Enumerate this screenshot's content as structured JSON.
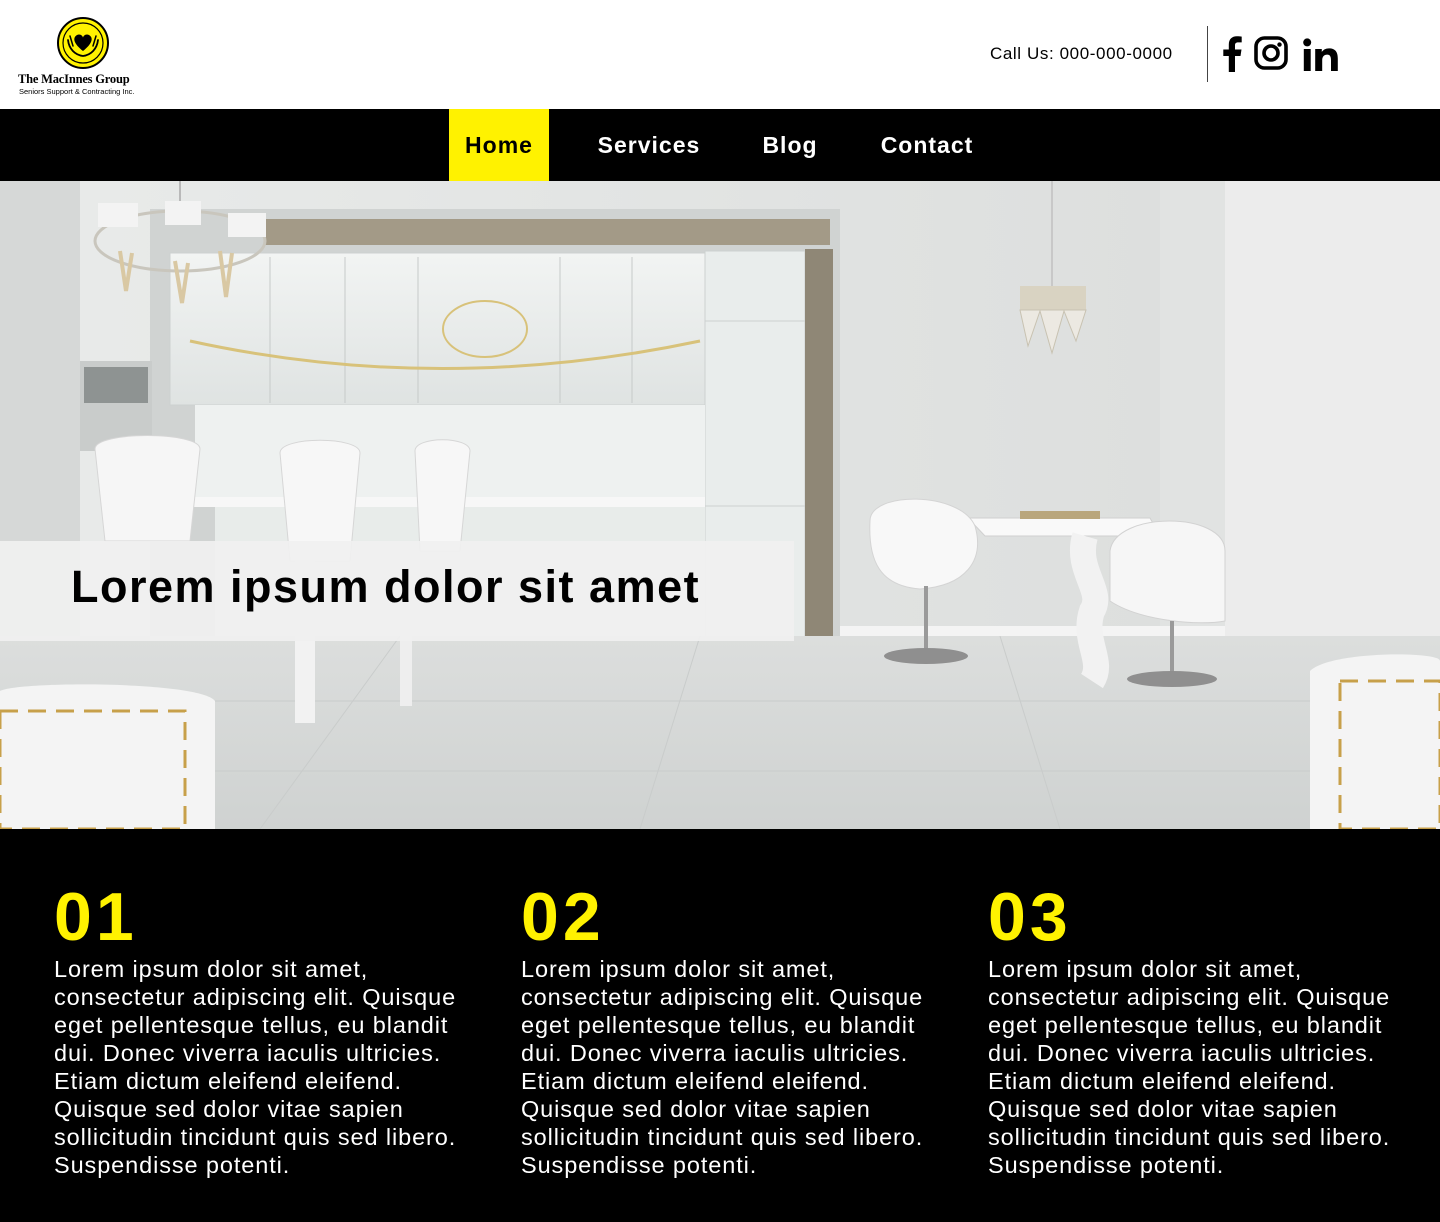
{
  "brand": {
    "name": "The MacInnes Group",
    "tagline": "Seniors Support & Contracting Inc.",
    "accent_color": "#FFF200",
    "logo_icon": "hands-holding-heart-icon"
  },
  "header": {
    "call_label": "Call Us: 000-000-0000",
    "social": [
      {
        "name": "facebook",
        "icon": "facebook-icon"
      },
      {
        "name": "instagram",
        "icon": "instagram-icon"
      },
      {
        "name": "linkedin",
        "icon": "linkedin-icon"
      }
    ]
  },
  "nav": {
    "items": [
      {
        "label": "Home",
        "active": true
      },
      {
        "label": "Services",
        "active": false
      },
      {
        "label": "Blog",
        "active": false
      },
      {
        "label": "Contact",
        "active": false
      }
    ]
  },
  "hero": {
    "image": "white-kitchen-dining-room-photo",
    "title": "Lorem ipsum dolor sit amet"
  },
  "features": [
    {
      "number": "01",
      "text": "Lorem ipsum dolor sit amet, consectetur adipiscing elit. Quisque eget pellentesque tellus, eu blandit dui. Donec viverra iaculis ultricies. Etiam dictum eleifend eleifend. Quisque sed dolor vitae sapien sollicitudin tincidunt quis sed libero. Suspendisse potenti."
    },
    {
      "number": "02",
      "text": "Lorem ipsum dolor sit amet, consectetur adipiscing elit. Quisque eget pellentesque tellus, eu blandit dui. Donec viverra iaculis ultricies. Etiam dictum eleifend eleifend. Quisque sed dolor vitae sapien sollicitudin tincidunt quis sed libero. Suspendisse potenti."
    },
    {
      "number": "03",
      "text": "Lorem ipsum dolor sit amet, consectetur adipiscing elit. Quisque eget pellentesque tellus, eu blandit dui. Donec viverra iaculis ultricies. Etiam dictum eleifend eleifend. Quisque sed dolor vitae sapien sollicitudin tincidunt quis sed libero. Suspendisse potenti."
    }
  ]
}
